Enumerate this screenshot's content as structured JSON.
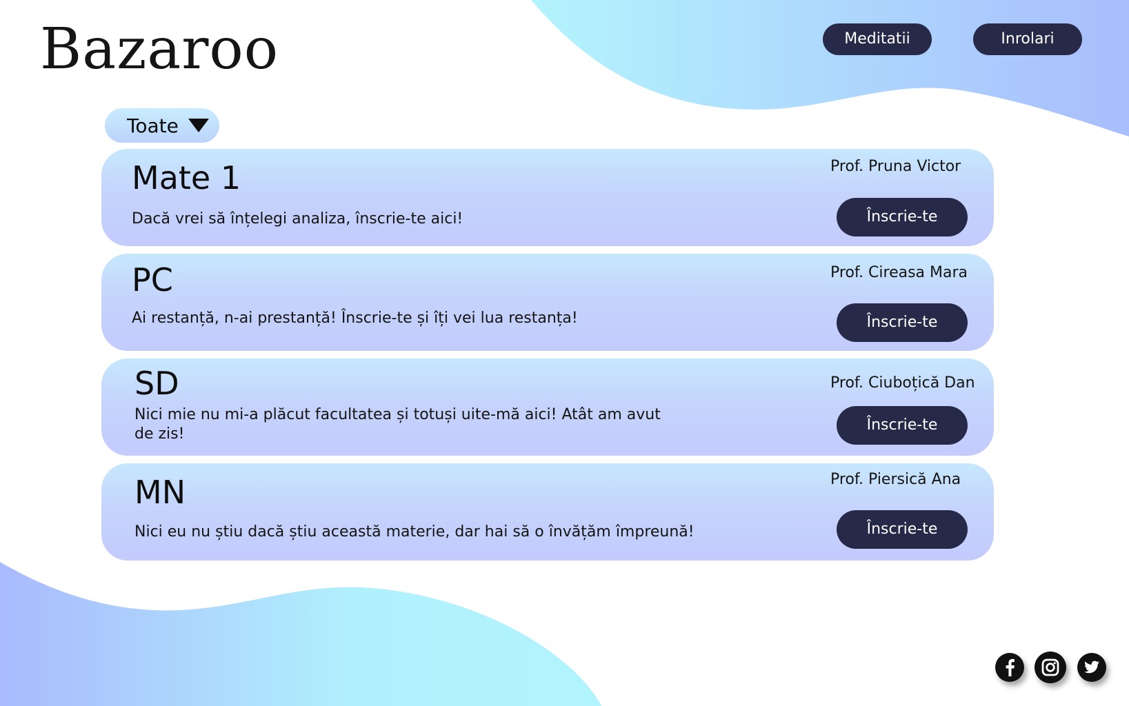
{
  "header": {
    "logo": "Bazaroo",
    "nav": [
      {
        "label": "Meditatii"
      },
      {
        "label": "Inrolari"
      }
    ]
  },
  "filter": {
    "selected": "Toate"
  },
  "courses": [
    {
      "title": "Mate 1",
      "description": "Dacă vrei să înțelegi analiza, înscrie-te aici!",
      "professor": "Prof. Pruna Victor",
      "button_label": "Înscrie-te"
    },
    {
      "title": "PC",
      "description": "Ai restanță, n-ai prestanță! Înscrie-te și îți vei lua restanța!",
      "professor": "Prof. Cireasa Mara",
      "button_label": "Înscrie-te"
    },
    {
      "title": "SD",
      "description": "Nici mie nu mi-a plăcut facultatea și totuși uite-mă aici! Atât am avut de zis!",
      "professor": "Prof. Ciuboțică Dan",
      "button_label": "Înscrie-te"
    },
    {
      "title": "MN",
      "description": "Nici eu nu știu dacă știu această materie, dar hai să o învățăm împreună!",
      "professor": "Prof. Piersică Ana",
      "button_label": "Înscrie-te"
    }
  ],
  "social": [
    "facebook-icon",
    "instagram-icon",
    "twitter-icon"
  ],
  "colors": {
    "button_bg": "#262a48",
    "wave_light": "#b3f2fd",
    "wave_blue": "#aabffd",
    "card_top": "#c6e8fd",
    "card_bottom": "#c4cbfd"
  }
}
